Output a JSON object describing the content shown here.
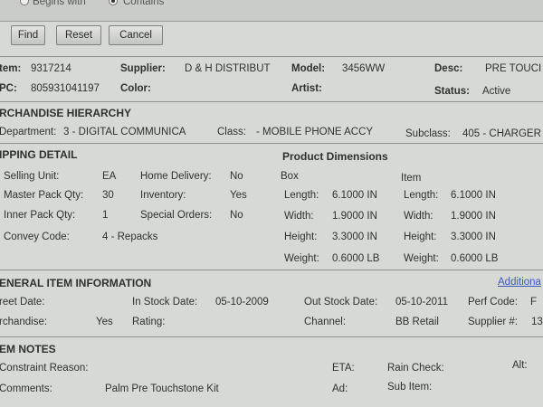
{
  "search": {
    "option_begins": "Begins with",
    "option_contains": "Contains",
    "selected": "Contains"
  },
  "buttons": {
    "find": "Find",
    "reset": "Reset",
    "cancel": "Cancel"
  },
  "item": {
    "item_label": "tem:",
    "item_value": "9317214",
    "supplier_label": "Supplier:",
    "supplier_value": "D & H DISTRIBUT",
    "model_label": "Model:",
    "model_value": "3456WW",
    "desc_label": "Desc:",
    "desc_value": "PRE TOUCI",
    "upc_label": "PC:",
    "upc_value": "805931041197",
    "color_label": "Color:",
    "artist_label": "Artist:",
    "status_label": "Status:",
    "status_value": "Active"
  },
  "hierarchy": {
    "title": "RCHANDISE HIERARCHY",
    "department_label": "Department:",
    "department_value": "3 - DIGITAL COMMUNICA",
    "class_label": "Class:",
    "class_value": "- MOBILE PHONE ACCY",
    "subclass_label": "Subclass:",
    "subclass_value": "405 - CHARGER"
  },
  "shipping": {
    "title": "IPPING DETAIL",
    "selling_unit_label": "Selling Unit:",
    "selling_unit_value": "EA",
    "master_pack_label": "Master Pack Qty:",
    "master_pack_value": "30",
    "inner_pack_label": "Inner Pack Qty:",
    "inner_pack_value": "1",
    "convey_label": "Convey Code:",
    "convey_value": "4 - Repacks",
    "home_delivery_label": "Home Delivery:",
    "home_delivery_value": "No",
    "inventory_label": "Inventory:",
    "inventory_value": "Yes",
    "special_orders_label": "Special Orders:",
    "special_orders_value": "No"
  },
  "dimensions": {
    "title": "Product Dimensions",
    "box_label": "Box",
    "item_label": "Item",
    "length_label": "Length:",
    "width_label": "Width:",
    "height_label": "Height:",
    "weight_label": "Weight:",
    "box_length": "6.1000 IN",
    "box_width": "1.9000 IN",
    "box_height": "3.3000 IN",
    "box_weight": "0.6000 LB",
    "item_length": "6.1000 IN",
    "item_width": "1.9000 IN",
    "item_height": "3.3000 IN",
    "item_weight": "0.6000 LB"
  },
  "general": {
    "title": "ENERAL ITEM INFORMATION",
    "additional_link": "Additiona",
    "street_date_label": "reet Date:",
    "in_stock_label": "In Stock Date:",
    "in_stock_value": "05-10-2009",
    "out_stock_label": "Out Stock Date:",
    "out_stock_value": "05-10-2011",
    "perf_code_label": "Perf Code:",
    "perf_code_value": "F",
    "merchandise_label": "rchandise:",
    "merchandise_value": "Yes",
    "rating_label": "Rating:",
    "channel_label": "Channel:",
    "channel_value": "BB Retail",
    "supplier_num_label": "Supplier #:",
    "supplier_num_value": "13"
  },
  "notes": {
    "title": "EM NOTES",
    "constraint_label": "Constraint Reason:",
    "eta_label": "ETA:",
    "rain_check_label": "Rain Check:",
    "alt_label": "Alt:",
    "comments_label": "Comments:",
    "comments_value": "Palm Pre Touchstone Kit",
    "ad_label": "Ad:",
    "sub_item_label": "Sub Item:"
  }
}
